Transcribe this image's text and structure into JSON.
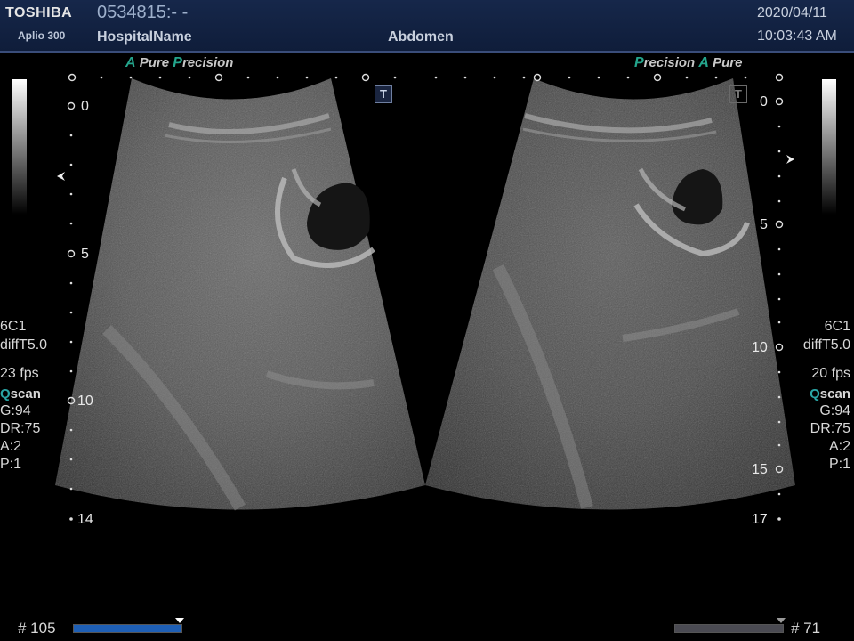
{
  "header": {
    "brand": "TOSHIBA",
    "model": "Aplio 300",
    "patient_id": "0534815:- -",
    "hospital": "HospitalName",
    "exam": "Abdomen",
    "date": "2020/04/11",
    "time": "10:03:43 AM"
  },
  "left_panel": {
    "brand_a": "A",
    "brand_pure": "Pure",
    "brand_p": "P",
    "brand_precision": "recision",
    "t_label": "T",
    "depth_marks": [
      "0",
      "5",
      "10",
      "14"
    ],
    "probe": "6C1",
    "preset": "diffT5.0",
    "fps": "23 fps",
    "scan_q": "Q",
    "scan_label": "scan",
    "gain": "G:94",
    "dr": "DR:75",
    "a": "A:2",
    "p": "P:1",
    "frame": "# 105",
    "frame_bar_fill": 1.0
  },
  "right_panel": {
    "brand_p": "P",
    "brand_precision": "recision",
    "brand_a": "A",
    "brand_pure": "Pure",
    "t_label": "T",
    "depth_marks": [
      "0",
      "5",
      "10",
      "15",
      "17"
    ],
    "probe": "6C1",
    "preset": "diffT5.0",
    "fps": "20 fps",
    "scan_q": "Q",
    "scan_label": "scan",
    "gain": "G:94",
    "dr": "DR:75",
    "a": "A:2",
    "p": "P:1",
    "frame": "# 71",
    "frame_bar_fill": 1.0
  },
  "colors": {
    "header_bg": "#16274a",
    "brand_accent": "#24a58c",
    "frame_bar_active": "#1e5fb5",
    "frame_bar_inactive": "#4a4a52"
  }
}
